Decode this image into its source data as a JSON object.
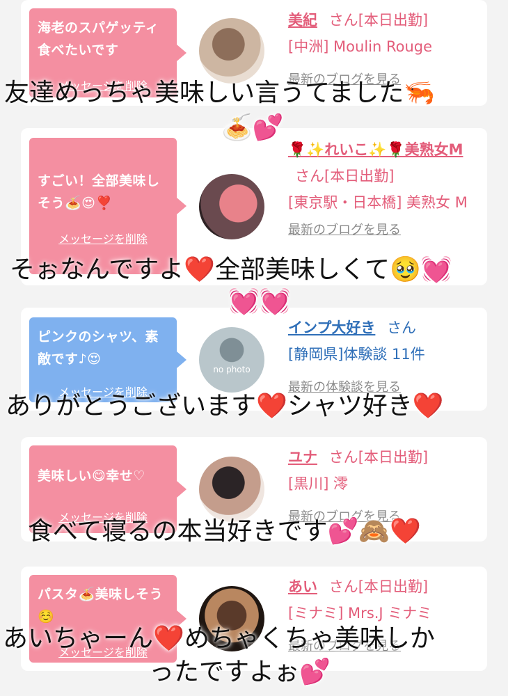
{
  "cards": [
    {
      "message": "海老のスパゲッティ食べたいです",
      "delete_label": "メッセージを削除",
      "name": "美紀",
      "honorific": "さん",
      "status": "[本日出勤]",
      "shop": "[中洲] Moulin Rouge",
      "link": "最新のブログを見る",
      "bubble_color": "#f48fa1"
    },
    {
      "message": "すごい！全部美味しそう🍝😍❣️",
      "delete_label": "メッセージを削除",
      "name": "🌹✨れいこ✨🌹美熟女M",
      "honorific": "さん",
      "status": "[本日出勤]",
      "shop": "[東京駅・日本橋] 美熟女 M",
      "link": "最新のブログを見る",
      "bubble_color": "#f48fa1"
    },
    {
      "message": "ピンクのシャツ、素敵です♪😍",
      "delete_label": "メッセージを削除",
      "name": "インプ大好き",
      "honorific": "さん",
      "status": "",
      "shop": "[静岡県]体験談 11件",
      "link": "最新の体験談を見る",
      "avatar_text": "no photo",
      "bubble_color": "#7fb1ef"
    },
    {
      "message": "美味しい😋幸せ♡",
      "delete_label": "メッセージを削除",
      "name": "ユナ",
      "honorific": "さん",
      "status": "[本日出勤]",
      "shop": "[黒川] 澪",
      "link": "最新のブログを見る",
      "bubble_color": "#f48fa1"
    },
    {
      "message": "パスタ🍝美味しそう☺️",
      "delete_label": "メッセージを削除",
      "name": "あい",
      "honorific": "さん",
      "status": "[本日出勤]",
      "shop": "[ミナミ] Mrs.J ミナミ",
      "link": "最新のブログを見る",
      "bubble_color": "#f48fa1"
    }
  ],
  "overlays": [
    "友達めっちゃ美味しい言うてました🦐",
    "🍝💕",
    "そぉなんですよ❤️全部美味しくて🥹💓",
    "💓💓",
    "ありがとうございます❤️シャツ好き❤️",
    "食べて寝るの本当好きです💕🙈❤️",
    "あいちゃーん❤️めちゃくちゃ美味しか",
    "ったですよぉ💕"
  ]
}
